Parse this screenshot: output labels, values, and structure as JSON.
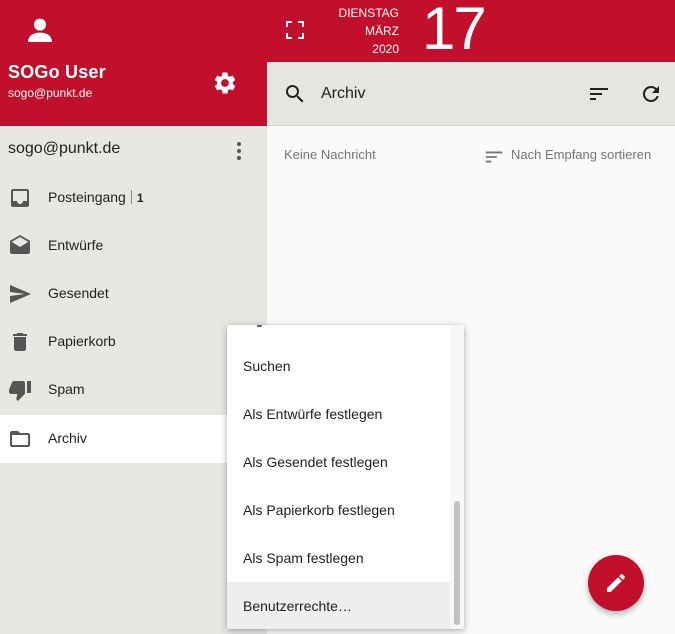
{
  "user": {
    "name": "SOGo User",
    "email": "sogo@punkt.de"
  },
  "date": {
    "weekday": "DIENSTAG",
    "month": "MÄRZ",
    "year": "2020",
    "day": "17"
  },
  "account": {
    "label": "sogo@punkt.de"
  },
  "folders": [
    {
      "label": "Posteingang",
      "icon": "inbox-icon",
      "unread": "1"
    },
    {
      "label": "Entwürfe",
      "icon": "drafts-icon"
    },
    {
      "label": "Gesendet",
      "icon": "send-icon"
    },
    {
      "label": "Papierkorb",
      "icon": "trash-icon"
    },
    {
      "label": "Spam",
      "icon": "thumb-down-icon"
    },
    {
      "label": "Archiv",
      "icon": "folder-icon",
      "active": true
    }
  ],
  "toolbar": {
    "title": "Archiv"
  },
  "list": {
    "empty_text": "Keine Nachricht",
    "sort_hint": "Nach Empfang sortieren"
  },
  "context_menu": {
    "items": [
      {
        "label": "Suchen"
      },
      {
        "label": "Als Entwürfe festlegen"
      },
      {
        "label": "Als Gesendet festlegen"
      },
      {
        "label": "Als Papierkorb festlegen"
      },
      {
        "label": "Als Spam festlegen"
      },
      {
        "label": "Benutzerrechte…",
        "highlighted": true
      }
    ]
  },
  "colors": {
    "brand": "#c2102c",
    "sidebar_bg": "#e8e7e4",
    "toolbar_bg": "#e6e5e2"
  }
}
